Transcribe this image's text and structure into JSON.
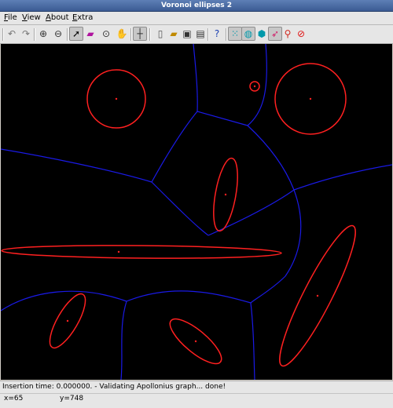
{
  "window": {
    "title": "Voronoi ellipses 2"
  },
  "menu": {
    "items": [
      "File",
      "View",
      "About",
      "Extra"
    ]
  },
  "toolbar": {
    "buttons": [
      {
        "icon": "undo-icon",
        "glyph": "↶",
        "color": "#777777"
      },
      {
        "icon": "redo-icon",
        "glyph": "↷",
        "color": "#777777"
      },
      {
        "icon": "zoom-in-icon",
        "glyph": "⊕",
        "color": "#333333"
      },
      {
        "icon": "zoom-out-icon",
        "glyph": "⊖",
        "color": "#333333"
      },
      {
        "icon": "select-pointer-icon",
        "glyph": "➚",
        "color": "#000000",
        "pressed": true
      },
      {
        "icon": "eraser-icon",
        "glyph": "▰",
        "color": "#b0159f"
      },
      {
        "icon": "crosshair-target-icon",
        "glyph": "⊙",
        "color": "#333333"
      },
      {
        "icon": "pan-hand-icon",
        "glyph": "✋",
        "color": "#555555"
      },
      {
        "icon": "insert-point-icon",
        "glyph": "┼",
        "color": "#333333",
        "pressed": true
      },
      {
        "icon": "new-file-icon",
        "glyph": "▯",
        "color": "#555555"
      },
      {
        "icon": "open-folder-icon",
        "glyph": "▰",
        "color": "#c08a00"
      },
      {
        "icon": "save-disk-icon",
        "glyph": "▣",
        "color": "#333333"
      },
      {
        "icon": "print-icon",
        "glyph": "▤",
        "color": "#333333"
      },
      {
        "icon": "help-icon",
        "glyph": "?",
        "color": "#1a3fb0"
      },
      {
        "icon": "points-layer-icon",
        "glyph": "⁙",
        "color": "#0099aa",
        "pressed": true
      },
      {
        "icon": "ellipses-layer-icon",
        "glyph": "◍",
        "color": "#0099aa",
        "pressed": true
      },
      {
        "icon": "voronoi-layer-icon",
        "glyph": "⬢",
        "color": "#0099aa"
      },
      {
        "icon": "delaunay-layer-icon",
        "glyph": "➶",
        "color": "#d11a66",
        "pressed": true
      },
      {
        "icon": "zoom-reset-icon",
        "glyph": "⚲",
        "color": "#d0271d"
      },
      {
        "icon": "clear-icon",
        "glyph": "⊘",
        "color": "#e01010"
      }
    ]
  },
  "canvas": {
    "background": "#000000",
    "ellipse_color": "#ff2020",
    "edge_color": "#1a1ae6"
  },
  "status": {
    "message": "Insertion time: 0.000000. - Validating Apollonius graph... done!",
    "x_label": "x=65",
    "y_label": "y=748"
  }
}
